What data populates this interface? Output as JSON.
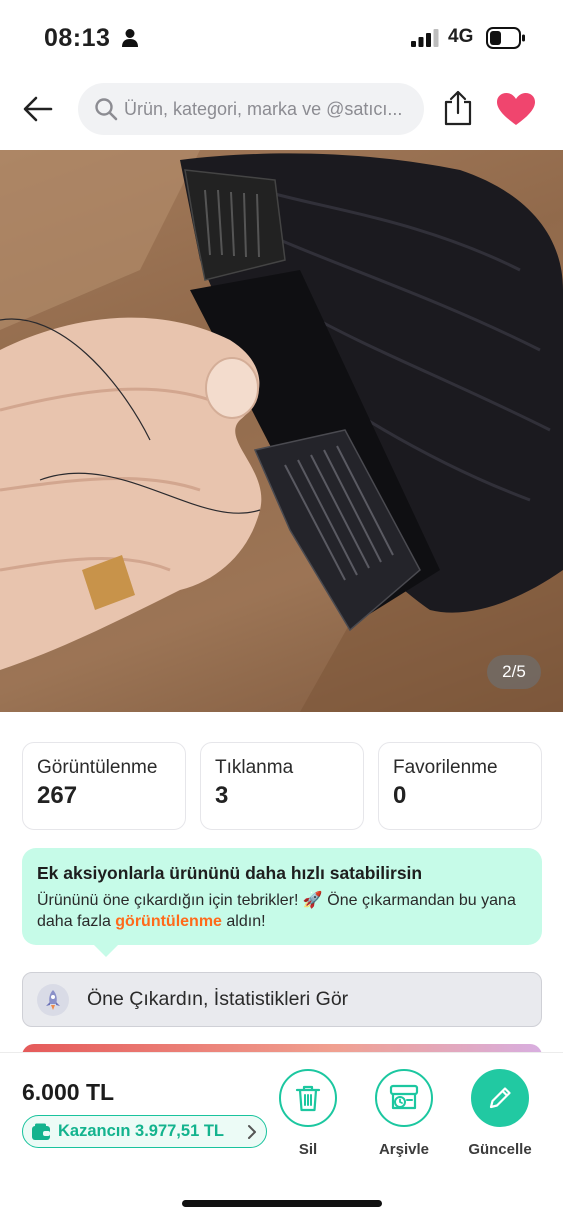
{
  "status_bar": {
    "time": "08:13",
    "network": "4G",
    "icons": [
      "person-icon",
      "signal-icon",
      "battery-icon"
    ]
  },
  "header": {
    "search_placeholder": "Ürün, kategori, marka ve @satıcı...",
    "icons": [
      "back-arrow-icon",
      "search-icon",
      "share-icon",
      "heart-icon"
    ],
    "favorite_color": "#f0456e"
  },
  "gallery": {
    "page_indicator": "2/5"
  },
  "stats": [
    {
      "label": "Görüntülenme",
      "value": "267"
    },
    {
      "label": "Tıklanma",
      "value": "3"
    },
    {
      "label": "Favorilenme",
      "value": "0"
    }
  ],
  "promo": {
    "title": "Ek aksiyonlarla ürününü daha hızlı satabilirsin",
    "body_before": "Ürününü öne çıkardığın için tebrikler! 🚀 Öne çıkarmandan bu yana daha fazla ",
    "body_highlight": "görüntülenme",
    "body_after": " aldın!",
    "background_color": "#c6fbe8",
    "highlight_color": "#ff6a1a"
  },
  "promote_button": {
    "label": "Öne Çıkardın, İstatistikleri Gör",
    "icon": "rocket-icon"
  },
  "bottom_bar": {
    "price": "6.000 TL",
    "earnings": "Kazancın 3.977,51 TL",
    "accent_color": "#1cc7a0",
    "actions": [
      {
        "label": "Sil",
        "icon": "trash-icon"
      },
      {
        "label": "Arşivle",
        "icon": "archive-icon"
      },
      {
        "label": "Güncelle",
        "icon": "pencil-icon"
      }
    ]
  }
}
